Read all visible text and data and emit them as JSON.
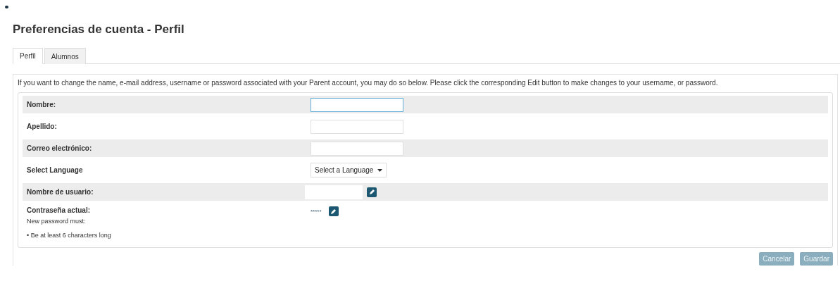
{
  "title": "Preferencias de cuenta - Perfil",
  "tabs": [
    {
      "label": "Perfil",
      "selected": true
    },
    {
      "label": "Alumnos",
      "selected": false
    }
  ],
  "intro": "If you want to change the name, e-mail address, username or password associated with your Parent account, you may do so below. Please click the corresponding Edit button to make changes to your username, or password.",
  "rows": [
    {
      "kind": "input",
      "label": "Nombre:",
      "focused": true
    },
    {
      "kind": "input",
      "label": "Apellido:",
      "focused": false
    },
    {
      "kind": "input",
      "label": "Correo electrónico:",
      "focused": false
    },
    {
      "kind": "select",
      "label": "Select Language",
      "value": "Select a Language"
    },
    {
      "kind": "edit",
      "label": "Nombre de usuario:"
    },
    {
      "kind": "edit",
      "label": "Contraseña actual:",
      "value": "*****",
      "hint": "New password must:",
      "rules": [
        "• Be at least 6 characters long"
      ]
    }
  ],
  "buttons": [
    {
      "label": "Cancelar",
      "disabled": true
    },
    {
      "label": "Guardar",
      "disabled": true
    }
  ]
}
